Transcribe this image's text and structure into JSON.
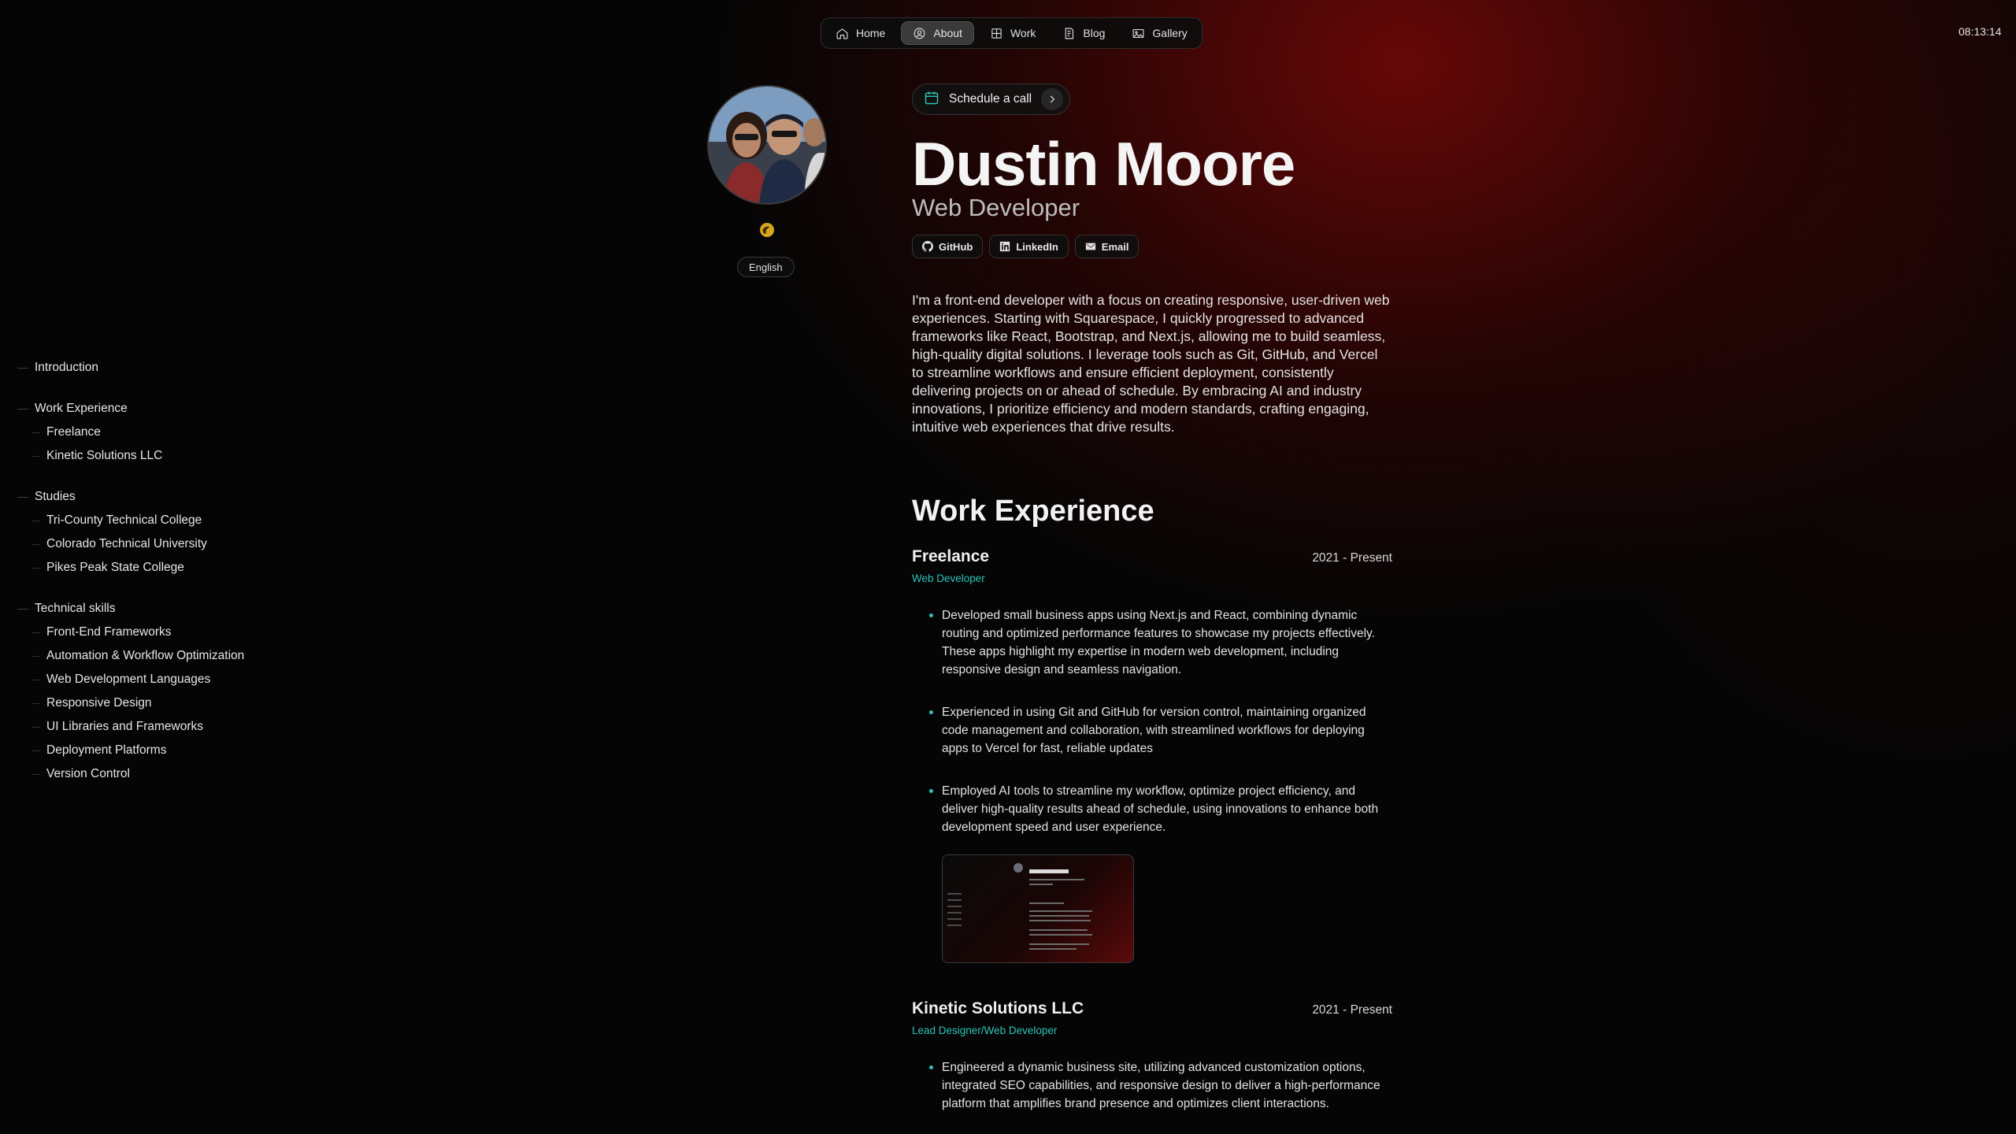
{
  "nav": {
    "items": [
      {
        "label": "Home",
        "icon": "home-icon"
      },
      {
        "label": "About",
        "icon": "person-icon",
        "active": true
      },
      {
        "label": "Work",
        "icon": "grid-icon"
      },
      {
        "label": "Blog",
        "icon": "book-icon"
      },
      {
        "label": "Gallery",
        "icon": "image-icon"
      }
    ]
  },
  "clock": "08:13:14",
  "toc": {
    "groups": [
      {
        "label": "Introduction",
        "items": []
      },
      {
        "label": "Work Experience",
        "items": [
          "Freelance",
          "Kinetic Solutions LLC"
        ]
      },
      {
        "label": "Studies",
        "items": [
          "Tri-County Technical College",
          "Colorado Technical University",
          "Pikes Peak State College"
        ]
      },
      {
        "label": "Technical skills",
        "items": [
          "Front-End Frameworks",
          "Automation & Workflow Optimization",
          "Web Development Languages",
          "Responsive Design",
          "UI Libraries and Frameworks",
          "Deployment Platforms",
          "Version Control"
        ]
      }
    ]
  },
  "profile": {
    "language": "English",
    "schedule_label": "Schedule a call",
    "name": "Dustin Moore",
    "role": "Web Developer",
    "socials": [
      {
        "label": "GitHub",
        "icon": "github-icon"
      },
      {
        "label": "LinkedIn",
        "icon": "linkedin-icon"
      },
      {
        "label": "Email",
        "icon": "email-icon"
      }
    ],
    "intro": "I'm a front-end developer with a focus on creating responsive, user-driven web experiences. Starting with Squarespace, I quickly progressed to advanced frameworks like React, Bootstrap, and Next.js, allowing me to build seamless, high-quality digital solutions. I leverage tools such as Git, GitHub, and Vercel to streamline workflows and ensure efficient deployment, consistently delivering projects on or ahead of schedule. By embracing AI and industry innovations, I prioritize efficiency and modern standards, crafting engaging, intuitive web experiences that drive results."
  },
  "work": {
    "title": "Work Experience",
    "jobs": [
      {
        "company": "Freelance",
        "dates": "2021 - Present",
        "title": "Web Developer",
        "bullets": [
          "Developed small business apps using Next.js and React, combining dynamic routing and optimized performance features to showcase my projects effectively. These apps highlight my expertise in modern web development, including responsive design and seamless navigation.",
          "Experienced in using Git and GitHub for version control, maintaining organized code management and collaboration, with streamlined workflows for deploying apps to Vercel for fast, reliable updates",
          "Employed AI tools to streamline my workflow, optimize project efficiency, and deliver high-quality results ahead of schedule, using innovations to enhance both development speed and user experience."
        ]
      },
      {
        "company": "Kinetic Solutions LLC",
        "dates": "2021 - Present",
        "title": "Lead Designer/Web Developer",
        "bullets": [
          "Engineered a dynamic business site, utilizing advanced customization options, integrated SEO capabilities, and responsive design to deliver a high-performance platform that amplifies brand presence and optimizes client interactions."
        ]
      }
    ]
  },
  "colors": {
    "accent": "#2ec4b6",
    "glow": "#780808",
    "background": "#050505"
  }
}
